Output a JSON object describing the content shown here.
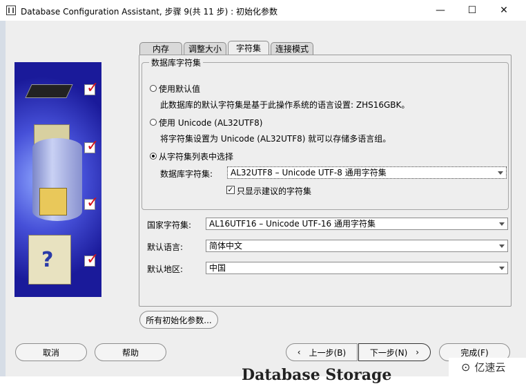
{
  "window": {
    "title": "Database Configuration Assistant, 步骤 9(共 11 步) : 初始化参数",
    "minimize": "—",
    "maximize": "☐",
    "close": "✕"
  },
  "tabs": [
    "内存",
    "调整大小",
    "字符集",
    "连接模式"
  ],
  "active_tab": "字符集",
  "group": {
    "title": "数据库字符集",
    "option_default": "使用默认值",
    "option_default_desc": "此数据库的默认字符集是基于此操作系统的语言设置: ZHS16GBK。",
    "option_unicode": "使用 Unicode (AL32UTF8)",
    "option_unicode_desc": "将字符集设置为 Unicode (AL32UTF8) 就可以存储多语言组。",
    "option_list": "从字符集列表中选择",
    "selected_option": "option_list",
    "db_charset_label": "数据库字符集:",
    "db_charset_value": "AL32UTF8 – Unicode UTF-8 通用字符集",
    "show_recommended_label": "只显示建议的字符集",
    "show_recommended_checked": true
  },
  "national": {
    "label": "国家字符集:",
    "value": "AL16UTF16 – Unicode UTF-16 通用字符集"
  },
  "language": {
    "label": "默认语言:",
    "value": "简体中文"
  },
  "territory": {
    "label": "默认地区:",
    "value": "中国"
  },
  "all_params_button": "所有初始化参数...",
  "footer": {
    "cancel": "取消",
    "help": "帮助",
    "back": "上一步(B)",
    "next": "下一步(N)",
    "finish": "完成(F)"
  },
  "watermark": "亿速云",
  "background_text": "Database Storage",
  "icons": [
    "chip-icon",
    "database-icon",
    "folder-icon",
    "help-folder-icon",
    "checkmark-icon"
  ],
  "colors": {
    "art_background": "#1a1a9a",
    "check": "#d4101a"
  }
}
